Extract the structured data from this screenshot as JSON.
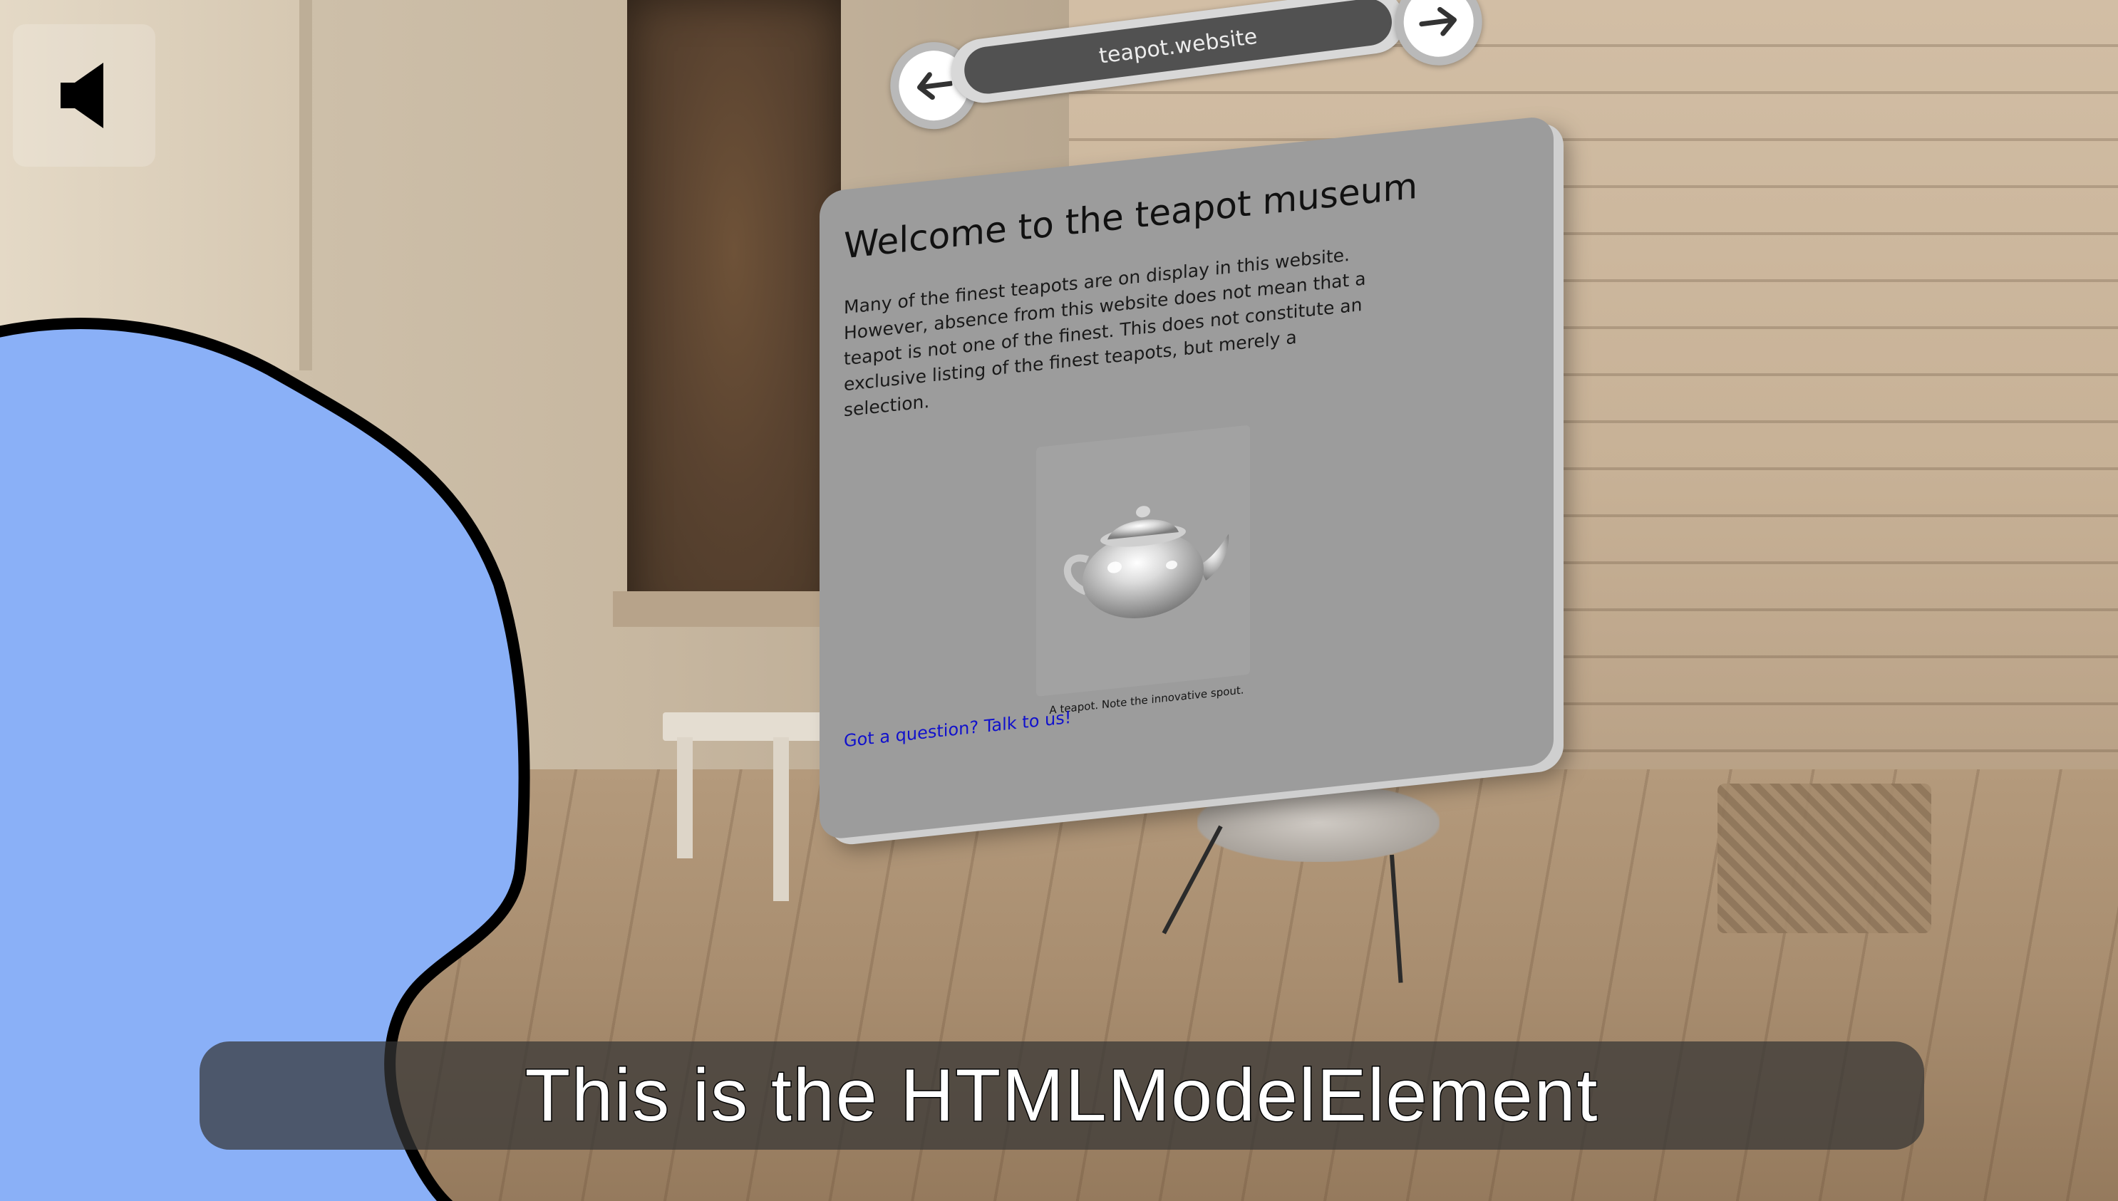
{
  "browser": {
    "url": "teapot.website"
  },
  "page": {
    "title": "Welcome to the teapot museum",
    "intro": "Many of the finest teapots are on display in this website. However, absence from this website does not mean that a teapot is not one of the finest. This does not constitute an exclusive listing of the finest teapots, but merely a selection.",
    "figure_caption": "A teapot. Note the innovative spout.",
    "contact_link": "Got a question? Talk to us!"
  },
  "caption": {
    "text": "This is the HTMLModelElement"
  },
  "icons": {
    "mute": "speaker-icon",
    "back": "arrow-left-icon",
    "forward": "arrow-right-icon",
    "model": "teapot-model"
  },
  "colors": {
    "blob_fill": "#8ab0f7",
    "blob_outline": "#000000",
    "panel": "#9c9c9c",
    "link": "#1111cc",
    "caption_bg": "#343434"
  }
}
